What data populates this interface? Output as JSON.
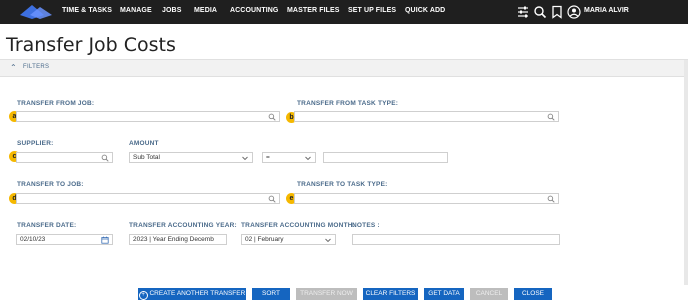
{
  "colors": {
    "topbar": "#1f1f1f",
    "accent": "#1565c0",
    "label": "#4a6a8a",
    "badge": "#f5b800",
    "disabled": "#bdbdbd"
  },
  "nav": {
    "items": [
      "TIME & TASKS",
      "MANAGE",
      "JOBS",
      "MEDIA",
      "ACCOUNTING",
      "MASTER FILES",
      "SET UP FILES",
      "QUICK ADD"
    ],
    "icons": [
      "sliders-icon",
      "search-icon",
      "bookmark-icon",
      "user-circle-icon"
    ],
    "user": "MARIA ALVIR"
  },
  "page": {
    "title": "Transfer Job Costs"
  },
  "filters": {
    "label": "FILTERS"
  },
  "form": {
    "transfer_from_job": {
      "label": "TRANSFER FROM  JOB:",
      "value": "",
      "badge": "a"
    },
    "transfer_from_task_type": {
      "label": "TRANSFER FROM TASK TYPE:",
      "value": "",
      "badge": "b"
    },
    "supplier": {
      "label": "SUPPLIER:",
      "value": "",
      "badge": "c"
    },
    "amount": {
      "label": "AMOUNT",
      "type_value": "Sub Total",
      "operator_value": "=",
      "value": ""
    },
    "transfer_to_job": {
      "label": "TRANSFER TO  JOB:",
      "value": "",
      "badge": "d"
    },
    "transfer_to_task_type": {
      "label": "TRANSFER TO TASK TYPE:",
      "value": "",
      "badge": "e"
    },
    "transfer_date": {
      "label": "TRANSFER DATE:",
      "value": "02/10/23"
    },
    "transfer_accounting_year": {
      "label": "TRANSFER ACCOUNTING YEAR:",
      "value": "2023 | Year Ending Decemb"
    },
    "transfer_accounting_month": {
      "label": "TRANSFER ACCOUNTING MONTH:",
      "value": "02 | February"
    },
    "notes": {
      "label": "NOTES :",
      "value": ""
    }
  },
  "footer": {
    "create_another": "CREATE ANOTHER TRANSFER",
    "sort": "SORT",
    "transfer_now": "TRANSFER NOW",
    "clear_filters": "CLEAR FILTERS",
    "get_data": "GET DATA",
    "cancel": "CANCEL",
    "close": "CLOSE"
  }
}
